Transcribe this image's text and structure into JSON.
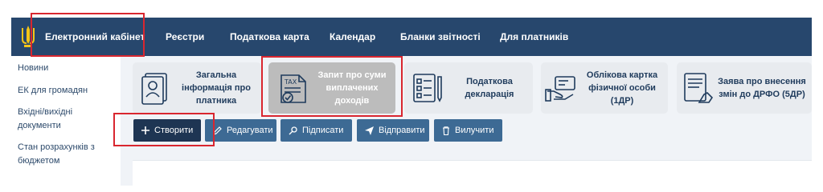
{
  "topbar": {
    "items": [
      {
        "label": "Електронний кабінет"
      },
      {
        "label": "Реєстри"
      },
      {
        "label": "Податкова карта"
      },
      {
        "label": "Календар"
      },
      {
        "label": "Бланки звітності"
      },
      {
        "label": "Для платників"
      }
    ]
  },
  "sidebar": {
    "items": [
      {
        "label": "Новини"
      },
      {
        "label": "ЕК для громадян"
      },
      {
        "label": "Вхідні/вихідні документи"
      },
      {
        "label": "Стан розрахунків з бюджетом"
      }
    ]
  },
  "cards": [
    {
      "label": "Загальна інформація про платника",
      "icon": "id-card-icon"
    },
    {
      "label": "Запит про суми виплачених доходів",
      "icon": "tax-document-icon"
    },
    {
      "label": "Податкова декларація",
      "icon": "checklist-icon"
    },
    {
      "label": "Облікова картка фізичної особи (1ДР)",
      "icon": "hand-card-icon"
    },
    {
      "label": "Заява про внесення змін до ДРФО (5ДР)",
      "icon": "application-icon"
    }
  ],
  "actions": {
    "create": "Створити",
    "edit": "Редагувати",
    "sign": "Підписати",
    "send": "Відправити",
    "unload": "Вилучити"
  },
  "colors": {
    "topbar": "#27476d",
    "active_card": "#bcbcbc",
    "button": "#3d6a94",
    "primary_button": "#1e3553",
    "highlight": "#d9262f"
  }
}
